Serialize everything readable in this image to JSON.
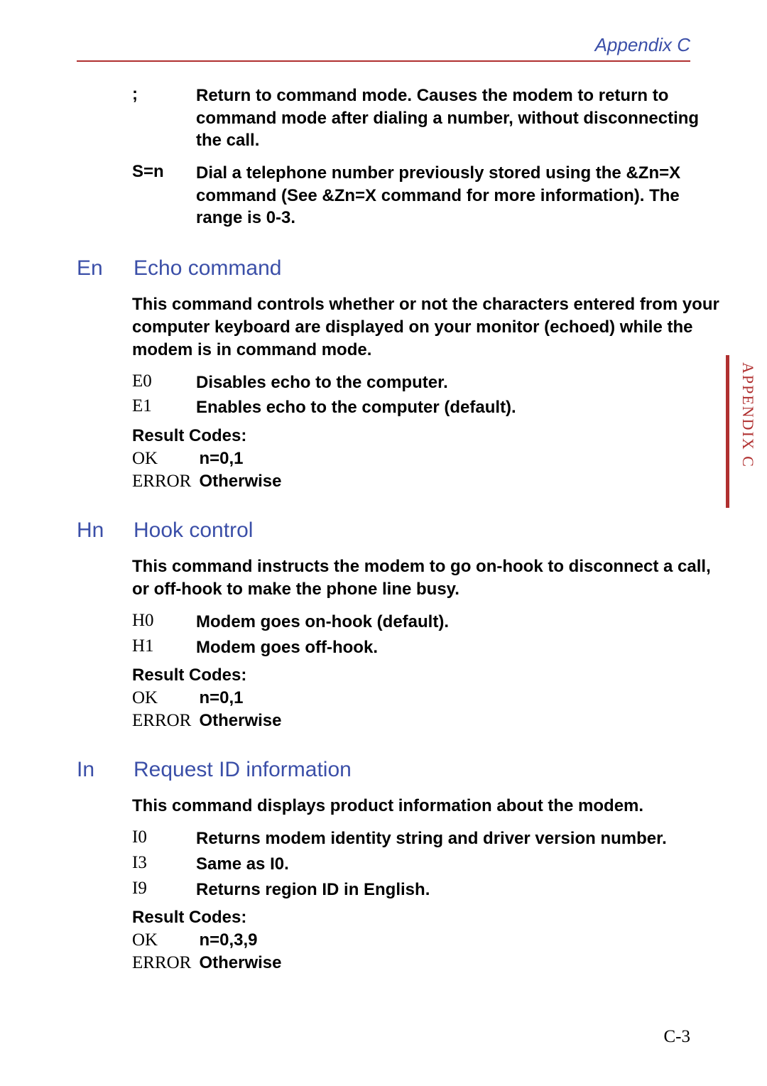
{
  "header": {
    "title": "Appendix C"
  },
  "sideTab": {
    "label": "APPENDIX C"
  },
  "pageNumber": "C-3",
  "intro": [
    {
      "code": ";",
      "text": "Return to command mode. Causes the modem to return to command mode after dialing a number, without disconnecting the call."
    },
    {
      "code": "S=n",
      "text": "Dial a telephone number previously stored using the &Zn=X command (See &Zn=X command for more information). The range is 0-3."
    }
  ],
  "sections": [
    {
      "code": "En",
      "title": "Echo command",
      "desc": "This command controls whether or not the characters entered from your computer keyboard are displayed on your monitor (echoed) while the modem is in command mode.",
      "items": [
        {
          "code": "E0",
          "text": "Disables echo to the computer."
        },
        {
          "code": "E1",
          "text": "Enables echo to the computer (default)."
        }
      ],
      "resultLabel": "Result Codes:",
      "results": [
        {
          "code": "OK",
          "text": "n=0,1"
        },
        {
          "code": "ERROR",
          "text": "Otherwise"
        }
      ]
    },
    {
      "code": "Hn",
      "title": "Hook control",
      "desc": "This command instructs the modem to go on-hook to disconnect a call, or off-hook to make the phone line busy.",
      "items": [
        {
          "code": "H0",
          "text": "Modem goes on-hook (default)."
        },
        {
          "code": "H1",
          "text": "Modem goes off-hook."
        }
      ],
      "resultLabel": "Result Codes:",
      "results": [
        {
          "code": "OK",
          "text": "n=0,1"
        },
        {
          "code": "ERROR",
          "text": "Otherwise"
        }
      ]
    },
    {
      "code": "In",
      "title": "Request ID information",
      "desc": "This command displays product information about the modem.",
      "items": [
        {
          "code": "I0",
          "text": "Returns modem identity string and driver version number."
        },
        {
          "code": "I3",
          "text": "Same as I0."
        },
        {
          "code": "I9",
          "text": "Returns region ID in English."
        }
      ],
      "resultLabel": "Result Codes:",
      "results": [
        {
          "code": "OK",
          "text": "n=0,3,9"
        },
        {
          "code": "ERROR",
          "text": "Otherwise"
        }
      ]
    }
  ]
}
